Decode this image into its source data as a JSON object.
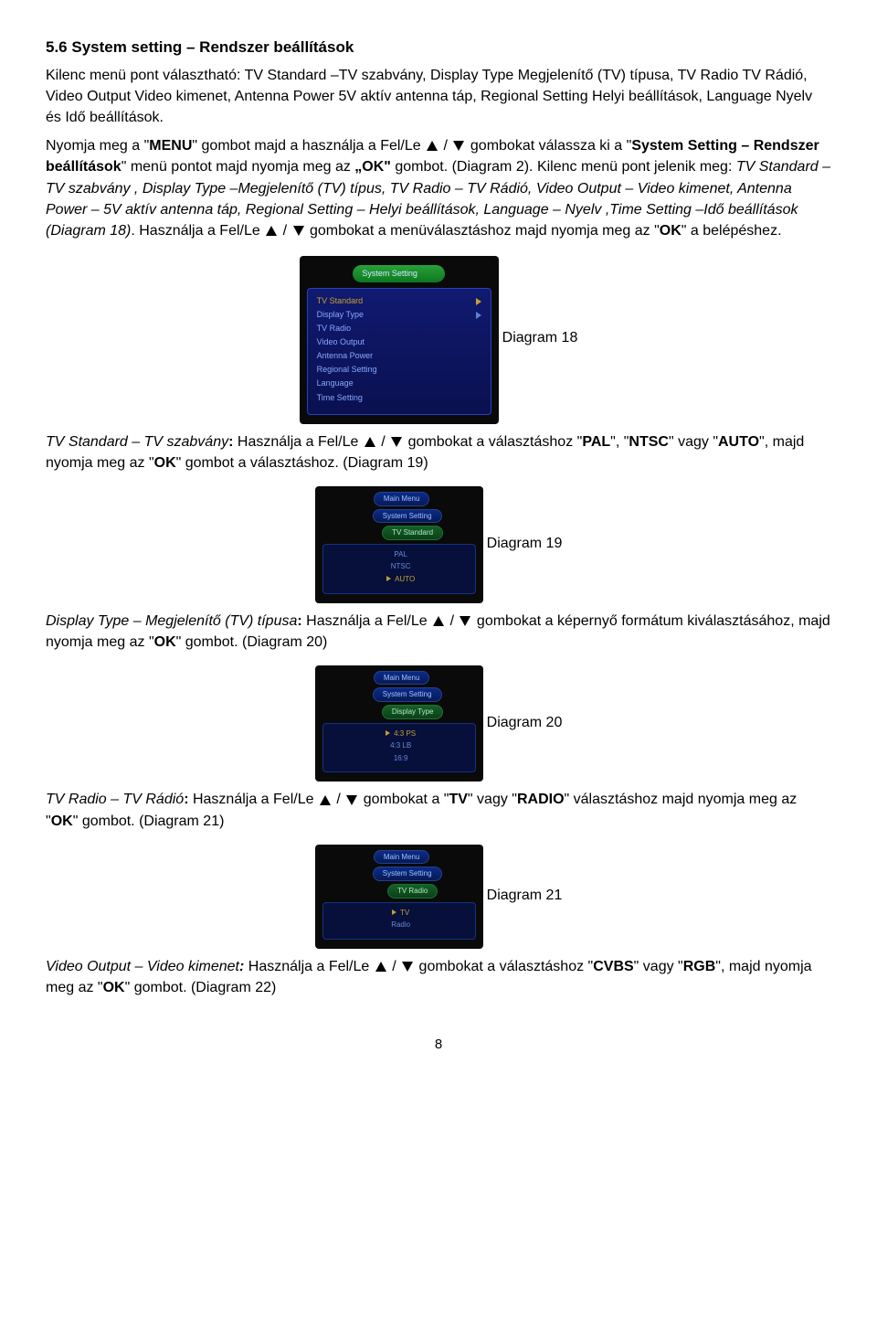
{
  "heading": "5.6   System setting – Rendszer beállítások",
  "intro": "Kilenc menü pont választható: TV Standard –TV szabvány, Display Type Megjelenítő (TV) típusa, TV Radio TV Rádió, Video Output Video kimenet, Antenna Power 5V aktív antenna táp, Regional Setting Helyi beállítások, Language Nyelv és Idő beállítások.",
  "p1a": "Nyomja meg a \"",
  "p1b": "MENU",
  "p1c": "\" gombot majd a használja a Fel/Le ",
  "p1d": " gombokat válassza ki a \"",
  "p1e": "System Setting – Rendszer beállítások",
  "p1f": "\" menü pontot majd nyomja meg az ",
  "p1g": "„OK\"",
  "p1h": " gombot. (Diagram 2). Kilenc menü pont jelenik meg: ",
  "p1i": "TV Standard – TV szabvány , Display Type –Megjelenítő (TV) típus, TV Radio – TV Rádió, Video Output – Video kimenet, Antenna Power – 5V aktív antenna táp, Regional Setting – Helyi beállítások, Language – Nyelv ,Time Setting –Idő beállítások",
  "p1j": "  (Diagram 18)",
  "p1k": ". Használja a Fel/Le ",
  "p1l": " gombokat a menüválasztáshoz majd nyomja meg az \"",
  "p1m": "OK",
  "p1n": "\" a belépéshez.",
  "d18tab": "System Setting",
  "d18items": [
    "TV Standard",
    "Display Type",
    "TV Radio",
    "Video Output",
    "Antenna Power",
    "Regional Setting",
    "Language",
    "Time Setting"
  ],
  "d18cap": "Diagram 18",
  "p2a": "TV Standard – TV szabvány",
  "p2b": ": ",
  "p2c": "Használja a Fel/Le ",
  "p2d": " gombokat  a választáshoz \"",
  "p2e": "PAL",
  "p2f": "\", \"",
  "p2g": "NTSC",
  "p2h": "\" vagy \"",
  "p2i": "AUTO",
  "p2j": "\", majd nyomja meg az \"",
  "p2k": "OK",
  "p2l": "\" gombot a választáshoz. (Diagram 19)",
  "d19crumb1": "Main Menu",
  "d19crumb2": "System Setting",
  "d19crumb3": "TV Standard",
  "d19items": [
    "PAL",
    "NTSC",
    "AUTO"
  ],
  "d19cap": "Diagram 19",
  "p3a": "Display Type – Megjelenítő (TV) típusa",
  "p3b": ": ",
  "p3c": "Használja a Fel/Le ",
  "p3d": " gombokat a képernyő formátum kiválasztásához, majd nyomja meg az \"",
  "p3e": "OK",
  "p3f": "\" gombot. (Diagram 20)",
  "d20crumb3": "Display Type",
  "d20items": [
    "4:3 PS",
    "4:3 LB",
    "16:9"
  ],
  "d20cap": "Diagram 20",
  "p4a": "TV Radio – TV Rádió",
  "p4b": ": ",
  "p4c": "Használja a Fel/Le ",
  "p4d": " gombokat a \"",
  "p4e": "TV",
  "p4f": "\" vagy \"",
  "p4g": "RADIO",
  "p4h": "\" választáshoz majd nyomja meg az \"",
  "p4i": "OK",
  "p4j": "\" gombot. (Diagram 21)",
  "d21crumb3": "TV Radio",
  "d21items": [
    "TV",
    "Radio"
  ],
  "d21cap": "Diagram 21",
  "p5a": "Video Output – Video kimenet",
  "p5b": ": ",
  "p5c": "Használja a Fel/Le ",
  "p5d": " gombokat a választáshoz \"",
  "p5e": "CVBS",
  "p5f": "\" vagy \"",
  "p5g": "RGB",
  "p5h": "\", majd nyomja meg az \"",
  "p5i": "OK",
  "p5j": "\" gombot. (Diagram 22)",
  "pagenum": "8"
}
